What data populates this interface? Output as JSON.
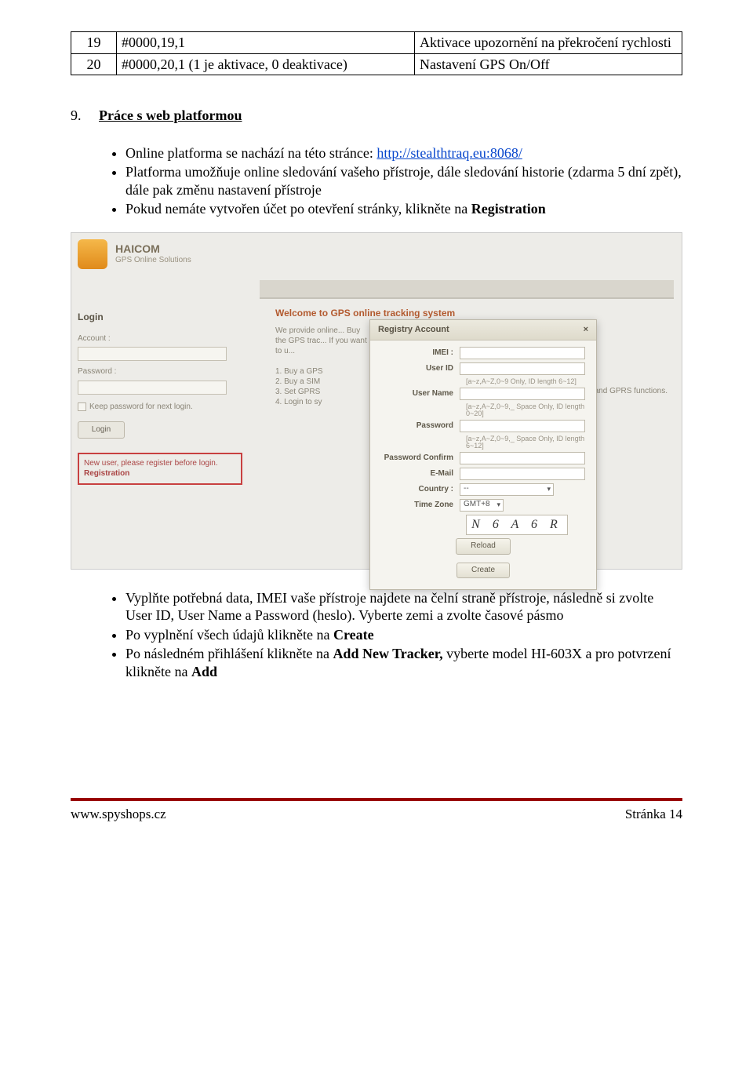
{
  "table": {
    "rows": [
      {
        "n": "19",
        "cmd": "#0000,19,1",
        "desc": "Aktivace upozornění na překročení rychlosti"
      },
      {
        "n": "20",
        "cmd": "#0000,20,1 (1 je aktivace, 0 deaktivace)",
        "desc": "Nastavení GPS On/Off"
      }
    ]
  },
  "section": {
    "number": "9.",
    "title": "Práce s web platformou"
  },
  "bullets_top": {
    "b1_pre": "Online platforma se nachází na této stránce: ",
    "b1_link": "http://stealthtraq.eu:8068/",
    "b2": "Platforma umožňuje online sledování vašeho přístroje, dále sledování historie (zdarma 5 dní zpět), dále pak změnu nastavení přístroje",
    "b3_pre": "Pokud nemáte vytvořen účet po otevření stránky, klikněte na ",
    "b3_bold": "Registration"
  },
  "screenshot": {
    "brand_title": "HAICOM",
    "brand_sub": "GPS Online Solutions",
    "login_title": "Login",
    "account_lbl": "Account :",
    "password_lbl": "Password :",
    "keep_lbl": "Keep password for next login.",
    "login_btn": "Login",
    "reg_prompt": "New user, please register before login.",
    "reg_link": "Registration",
    "welcome": "Welcome to GPS online tracking system",
    "welcome_sub": "We provide online... Buy the GPS trac... If you want to u...\n\n1. Buy a GPS\n2. Buy a SIM\n3. Set GPRS\n4. Login to sy",
    "side_note": "S and GPRS functions.",
    "dialog": {
      "title": "Registry Account",
      "close": "×",
      "imei": "IMEI :",
      "userid": "User ID",
      "hint_id": "[a~z,A~Z,0~9 Only, ID length 6~12]",
      "username": "User Name",
      "hint_name": "[a~z,A~Z,0~9,_ Space Only, ID length 0~20]",
      "password": "Password",
      "hint_pw": "[a~z,A~Z,0~9,_ Space Only, ID length 6~12]",
      "pwconfirm": "Password Confirm",
      "email": "E-Mail",
      "country": "Country :",
      "country_val": "--",
      "timezone": "Time Zone",
      "timezone_val": "GMT+8",
      "captcha": "N 6 A 6 R",
      "reload": "Reload",
      "create": "Create"
    }
  },
  "bullets_bottom": {
    "b1": "Vyplňte potřebná data, IMEI vaše přístroje najdete na čelní straně přístroje, následně si zvolte User ID, User Name a Password (heslo). Vyberte zemi a zvolte časové pásmo",
    "b2_pre": "Po vyplnění všech údajů klikněte na ",
    "b2_bold": "Create",
    "b3_pre": "Po následném přihlášení klikněte na ",
    "b3_bold1": "Add New Tracker,",
    "b3_mid": " vyberte model HI-603X a pro potvrzení klikněte na ",
    "b3_bold2": "Add"
  },
  "footer": {
    "left": "www.spyshops.cz",
    "right": "Stránka 14"
  }
}
